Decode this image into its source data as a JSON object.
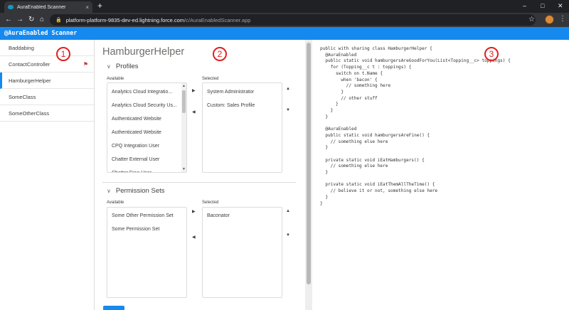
{
  "browser": {
    "tab_title": "AuraEnabled Scanner",
    "tab_close": "×",
    "new_tab": "+",
    "controls": {
      "minimize": "–",
      "maximize": "□",
      "close": "✕"
    },
    "nav": {
      "back": "←",
      "forward": "→",
      "reload": "↻",
      "home": "⌂"
    },
    "url_domain": "platform-platform-9835-dev-ed.lightning.force.com",
    "url_path": "/c/AuraEnabledScanner.app",
    "lock": "🔒",
    "star": "☆",
    "menu": "⋮"
  },
  "app": {
    "header_title": "@AuraEnabled Scanner"
  },
  "sidebar": {
    "items": [
      {
        "label": "Baddabing"
      },
      {
        "label": "ContactController",
        "flag": "⚑"
      },
      {
        "label": "HamburgerHelper"
      },
      {
        "label": "SomeClass"
      },
      {
        "label": "SomeOtherClass"
      }
    ]
  },
  "main": {
    "title": "HamburgerHelper",
    "profiles": {
      "title": "Profiles",
      "available_label": "Available",
      "selected_label": "Selected",
      "available": [
        "Analytics Cloud Integratio...",
        "Analytics Cloud Security Us...",
        "Authenticated Website",
        "Authenticated Website",
        "CPQ Integration User",
        "Chatter External User",
        "Chatter Free User"
      ],
      "selected": [
        "System Administrator",
        "Custom: Sales Profile"
      ]
    },
    "permission_sets": {
      "title": "Permission Sets",
      "available_label": "Available",
      "selected_label": "Selected",
      "available": [
        "Some Other Permission Set",
        "Some Permission Set"
      ],
      "selected": [
        "Baconator"
      ]
    },
    "arrows": {
      "right": "▶",
      "left": "◀",
      "up": "▲",
      "down": "▼"
    },
    "chevron": "∨"
  },
  "code": {
    "source": "public with sharing class HamburgerHelper {\n  @AuraEnabled\n  public static void hamburgersAreGoodForYou(List<Topping__c> toppings) {\n    for (Topping__c t : toppings) {\n      switch on t.Name {\n        when 'bacon' {\n          // something here\n        }\n        // other stuff\n      }\n    }\n  }\n\n  @AuraEnabled\n  public static void hamburgersAreFine() {\n    // something else here\n  }\n\n  private static void iEatHamburgers() {\n    // something else here\n  }\n\n  private static void iEatThemAllTheTime() {\n    // believe it or not, something else here\n  }\n}"
  },
  "markers": [
    "1",
    "2",
    "3"
  ]
}
